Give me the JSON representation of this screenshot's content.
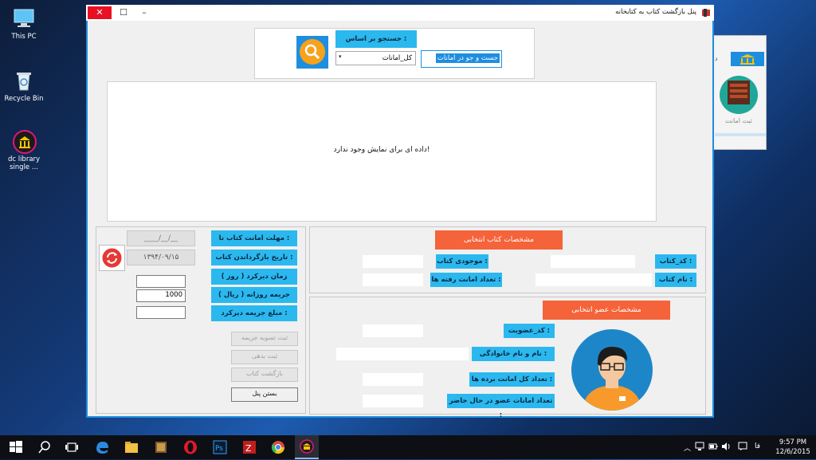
{
  "desktop": {
    "icons": [
      {
        "label": "This PC"
      },
      {
        "label": "Recycle Bin"
      },
      {
        "label": "dc library single ..."
      }
    ]
  },
  "window": {
    "title": "پنل بازگشت کتاب به کتابخانه",
    "search": {
      "by_label": "جستجو بر اساس :",
      "input_value": "جست و جو در امانات",
      "dropdown_value": "کل_امانات"
    },
    "grid": {
      "empty_message": "داده ای برای نمایش وجود ندارد!"
    },
    "book_panel": {
      "header": "مشخصات کتاب انتخابی",
      "code_label": "کد_کتاب :",
      "name_label": "نام کتاب :",
      "stock_label": "موجودی کتاب :",
      "loans_label": "تعداد امانت رفته ها :"
    },
    "member_panel": {
      "header": "مشخصات عضو انتخابی",
      "member_code_label": "کد_عضویت :",
      "fullname_label": "نام و نام خانوادگی :",
      "total_loans_label": "تعداد کل امانت برده ها :",
      "current_loans_label": "تعداد امانات عضو در حال حاضر :"
    },
    "return_panel": {
      "due_label": "مهلت امانت کتاب تا :",
      "return_date_label": "تاریخ بازگرداندن کتاب :",
      "late_label": "زمان دیرکرد ( روز )",
      "daily_fine_label": "جریمه روزانه ( ریال )",
      "fine_amount_label": "مبلغ جریمه دیرکرد :",
      "due_value": "____/__/__",
      "return_date_value": "۱۳۹۴/۰۹/۱۵",
      "daily_fine_value": "1000",
      "settle_button": "ثبت تسویه جریمه",
      "debt_button": "ثبت بدهی",
      "return_button": "بازگشت کتاب",
      "close_button": "بستن پنل"
    }
  },
  "bg_window": {
    "label": "ثبت امانت"
  },
  "taskbar": {
    "lang": "فا",
    "time": "9:57 PM",
    "date": "12/6/2015"
  },
  "colors": {
    "accent_blue": "#2bb8ee",
    "accent_orange": "#f4633a",
    "window_border": "#1e8ee0"
  }
}
